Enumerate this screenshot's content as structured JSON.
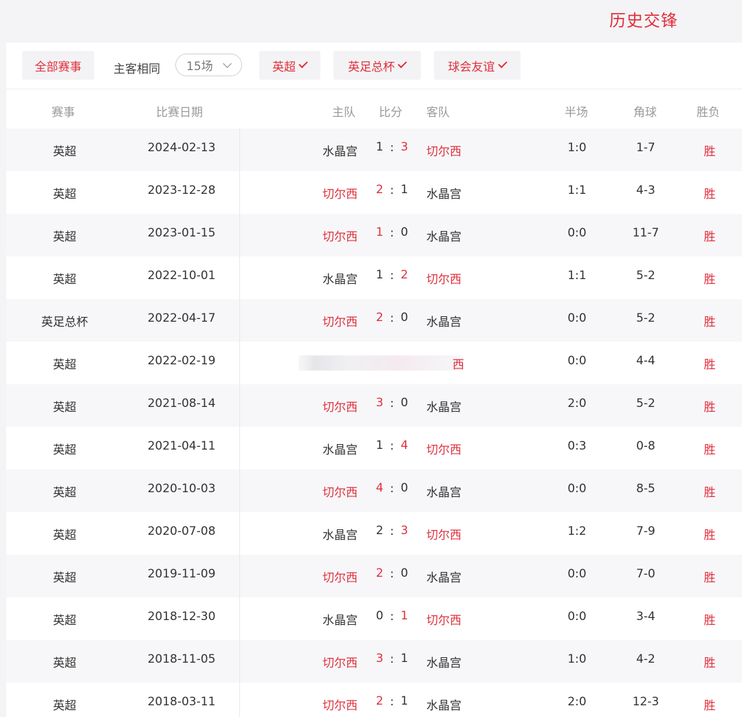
{
  "page": {
    "title": "历史交锋"
  },
  "filters": {
    "all_label": "全部赛事",
    "same_label": "主客相同",
    "count_value": "15场",
    "chips": [
      "英超",
      "英足总杯",
      "球会友谊"
    ]
  },
  "headers": {
    "competition": "赛事",
    "date": "比赛日期",
    "home": "主队",
    "score": "比分",
    "away": "客队",
    "half": "半场",
    "corners": "角球",
    "result": "胜负"
  },
  "colon": ":",
  "matches": [
    {
      "competition": "英超",
      "date": "2024-02-13",
      "home": "水晶宫",
      "home_score": "1",
      "away_score": "3",
      "away": "切尔西",
      "half": "1:0",
      "corners": "1-7",
      "result": "胜"
    },
    {
      "competition": "英超",
      "date": "2023-12-28",
      "home": "切尔西",
      "home_score": "2",
      "away_score": "1",
      "away": "水晶宫",
      "half": "1:1",
      "corners": "4-3",
      "result": "胜"
    },
    {
      "competition": "英超",
      "date": "2023-01-15",
      "home": "切尔西",
      "home_score": "1",
      "away_score": "0",
      "away": "水晶宫",
      "half": "0:0",
      "corners": "11-7",
      "result": "胜"
    },
    {
      "competition": "英超",
      "date": "2022-10-01",
      "home": "水晶宫",
      "home_score": "1",
      "away_score": "2",
      "away": "切尔西",
      "half": "1:1",
      "corners": "5-2",
      "result": "胜"
    },
    {
      "competition": "英足总杯",
      "date": "2022-04-17",
      "home": "切尔西",
      "home_score": "2",
      "away_score": "0",
      "away": "水晶宫",
      "half": "0:0",
      "corners": "5-2",
      "result": "胜"
    },
    {
      "competition": "英超",
      "date": "2022-02-19",
      "away_fragment": "西",
      "half": "0:0",
      "corners": "4-4",
      "result": "胜"
    },
    {
      "competition": "英超",
      "date": "2021-08-14",
      "home": "切尔西",
      "home_score": "3",
      "away_score": "0",
      "away": "水晶宫",
      "half": "2:0",
      "corners": "5-2",
      "result": "胜"
    },
    {
      "competition": "英超",
      "date": "2021-04-11",
      "home": "水晶宫",
      "home_score": "1",
      "away_score": "4",
      "away": "切尔西",
      "half": "0:3",
      "corners": "0-8",
      "result": "胜"
    },
    {
      "competition": "英超",
      "date": "2020-10-03",
      "home": "切尔西",
      "home_score": "4",
      "away_score": "0",
      "away": "水晶宫",
      "half": "0:0",
      "corners": "8-5",
      "result": "胜"
    },
    {
      "competition": "英超",
      "date": "2020-07-08",
      "home": "水晶宫",
      "home_score": "2",
      "away_score": "3",
      "away": "切尔西",
      "half": "1:2",
      "corners": "7-9",
      "result": "胜"
    },
    {
      "competition": "英超",
      "date": "2019-11-09",
      "home": "切尔西",
      "home_score": "2",
      "away_score": "0",
      "away": "水晶宫",
      "half": "0:0",
      "corners": "7-0",
      "result": "胜"
    },
    {
      "competition": "英超",
      "date": "2018-12-30",
      "home": "水晶宫",
      "home_score": "0",
      "away_score": "1",
      "away": "切尔西",
      "half": "0:0",
      "corners": "3-4",
      "result": "胜"
    },
    {
      "competition": "英超",
      "date": "2018-11-05",
      "home": "切尔西",
      "home_score": "3",
      "away_score": "1",
      "away": "水晶宫",
      "half": "1:0",
      "corners": "4-2",
      "result": "胜"
    },
    {
      "competition": "英超",
      "date": "2018-03-11",
      "home": "切尔西",
      "home_score": "2",
      "away_score": "1",
      "away": "水晶宫",
      "half": "2:0",
      "corners": "12-3",
      "result": "胜"
    }
  ],
  "colors": {
    "accent": "#e0303c",
    "highlight_team": "切尔西"
  }
}
